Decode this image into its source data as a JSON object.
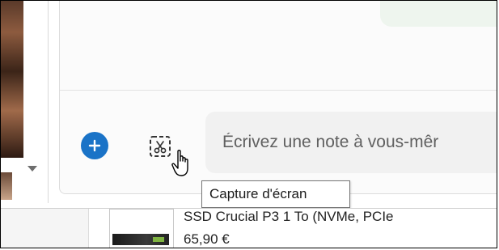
{
  "composer": {
    "placeholder": "Écrivez une note à vous-mêr",
    "add_icon": "plus-icon",
    "snip_icon": "screen-capture-icon",
    "tooltip": "Capture d'écran"
  },
  "product": {
    "name": "SSD Crucial P3 1 To (NVMe, PCIe",
    "price": "65,90 €"
  },
  "colors": {
    "accent": "#1a73c7",
    "input_bg": "#f1f1f1",
    "bubble": "#eef5ee"
  }
}
